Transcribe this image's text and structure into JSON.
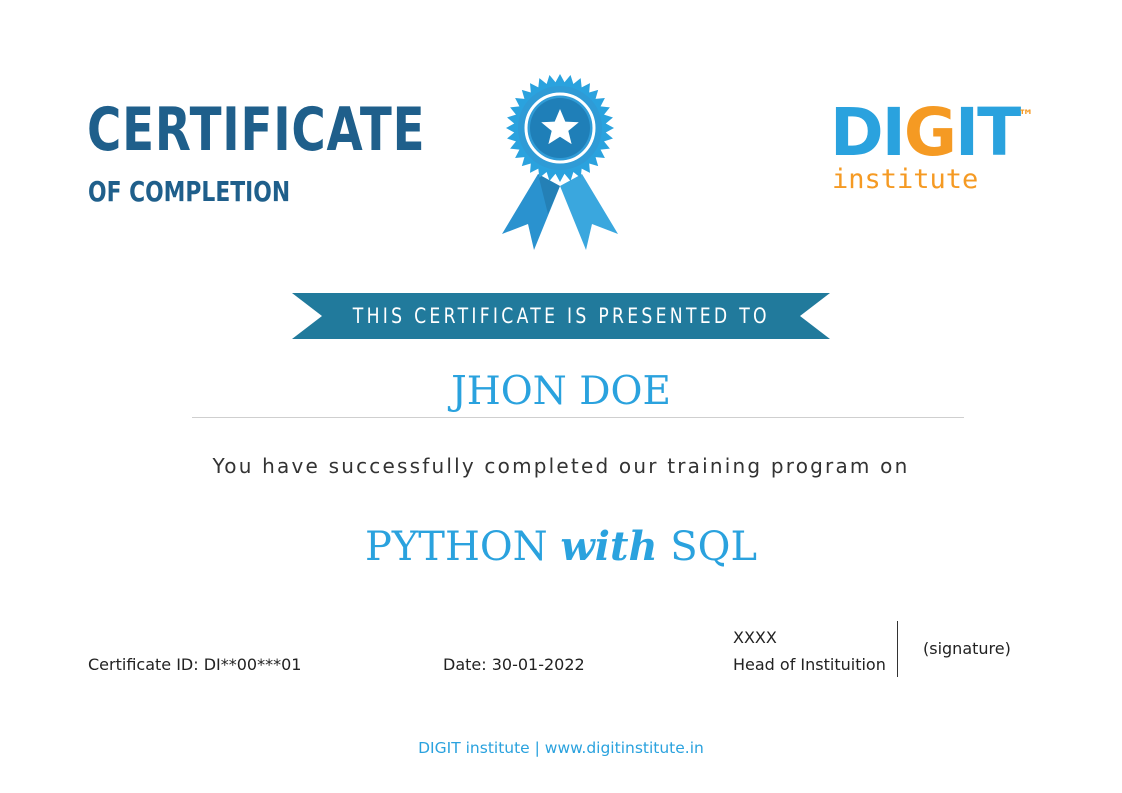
{
  "header": {
    "title": "CERTIFICATE",
    "subtitle": "OF COMPLETION"
  },
  "badge": {
    "icon": "award-ribbon-star-icon",
    "color": "#2aa2de"
  },
  "logo": {
    "word_blue_1": "D",
    "word_blue_2": "I",
    "word_orange": "G",
    "word_blue_3": "IT",
    "trademark": "™",
    "subtitle": "institute",
    "color_blue": "#2aa2de",
    "color_orange": "#f59a23"
  },
  "banner": {
    "text": "THIS CERTIFICATE IS PRESENTED TO",
    "color": "#217a9c"
  },
  "recipient": {
    "name": "JHON DOE"
  },
  "message": "You have successfully completed our training program on",
  "course": {
    "part1": "PYTHON",
    "part2": "with",
    "part3": "SQL"
  },
  "footer": {
    "certificate_id": "Certificate ID: DI**00***01",
    "date": "Date: 30-01-2022",
    "signer_name": "XXXX",
    "signer_title": "Head of Instituition",
    "signature": "(signature)"
  },
  "bottom": {
    "text": "DIGIT institute | www.digitinstitute.in"
  }
}
